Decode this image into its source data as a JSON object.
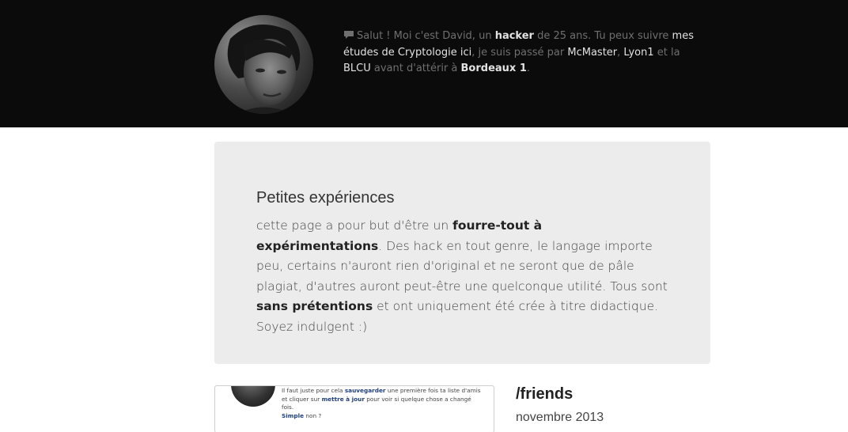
{
  "header": {
    "bio": {
      "part1": "Salut ! Moi c'est David, un ",
      "hacker": "hacker",
      "part2": " de 25 ans. Tu peux suivre ",
      "link_etudes": "mes études de Cryptologie ici",
      "part3": ", je suis passé par ",
      "link_mcmaster": "McMaster",
      "sep": ", ",
      "link_lyon1": "Lyon1",
      "part4": " et la ",
      "link_blcu": "BLCU",
      "part5": " avant d'attérir à ",
      "bordeaux": "Bordeaux 1",
      "part6": "."
    },
    "icon": "speech-bubble-icon"
  },
  "intro": {
    "title": "Petites expériences",
    "t1": "cette page a pour but d'être un ",
    "b1": "fourre-tout à expérimentations",
    "t2": ". Des hack en tout genre, le langage importe peu, certains n'auront rien d'original et ne seront que de pâle plagiat, d'autres auront peut-être une quelconque utilité. Tous sont ",
    "b2": "sans prétentions",
    "t3": " et ont uniquement été crée à titre didactique. Soyez indulgent :)"
  },
  "post": {
    "title": "/friends",
    "date": "novembre 2013",
    "thumb": {
      "l1a": "Il faut juste pour cela ",
      "l1b": "sauvegarder",
      "l1c": " une première fois ta liste d'amis",
      "l2a": "et cliquer sur ",
      "l2b": "mettre à jour",
      "l2c": " pour voir si quelque chose a changé",
      "l3": "fois.",
      "l4a": "Simple",
      "l4b": " non ?"
    }
  }
}
